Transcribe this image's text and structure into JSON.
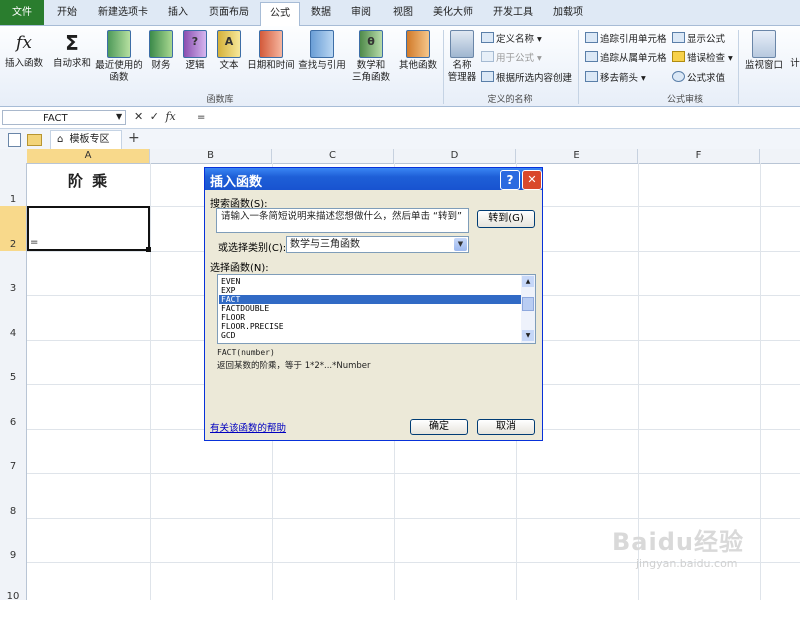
{
  "tabs": {
    "file": "文件",
    "home": "开始",
    "newtab": "新建选项卡",
    "insert": "插入",
    "layout": "页面布局",
    "formulas": "公式",
    "data": "数据",
    "review": "审阅",
    "view": "视图",
    "beauty": "美化大师",
    "dev": "开发工具",
    "addins": "加载项"
  },
  "ribbon": {
    "insert_function": "插入函数",
    "autosum_1": "自动求和",
    "recent_1": "最近使用的",
    "recent_2": "函数",
    "financial": "财务",
    "logical": "逻辑",
    "text": "文本",
    "datetime": "日期和时间",
    "lookup": "查找与引用",
    "math_1": "数学和",
    "math_2": "三角函数",
    "other": "其他函数",
    "group_library": "函数库",
    "name_mgr_1": "名称",
    "name_mgr_2": "管理器",
    "define_name": "定义名称",
    "use_in_formula": "用于公式",
    "create_from_sel": "根据所选内容创建",
    "group_names": "定义的名称",
    "trace_prec": "追踪引用单元格",
    "trace_dep": "追踪从属单元格",
    "remove_arrows": "移去箭头",
    "show_formulas": "显示公式",
    "error_check": "错误检查",
    "eval_formula": "公式求值",
    "group_audit": "公式审核",
    "watch_window": "监视窗口",
    "calc_trunc": "计",
    "fx_glyph": "fx",
    "sigma_glyph": "Σ",
    "text_glyph": "A",
    "theta_glyph": "θ",
    "q_glyph": "?"
  },
  "formula_bar": {
    "name_box": "FACT",
    "fx": "fx",
    "content": "="
  },
  "doc_tabs": {
    "template": "模板专区",
    "add": "+"
  },
  "columns": [
    "A",
    "B",
    "C",
    "D",
    "E",
    "F"
  ],
  "rows": [
    "1",
    "2",
    "3",
    "4",
    "5",
    "6",
    "7",
    "8",
    "9",
    "10"
  ],
  "cells": {
    "A1": "阶 乘",
    "A2": "="
  },
  "dialog": {
    "title": "插入函数",
    "help_btn": "?",
    "close_btn": "✕",
    "search_label": "搜索函数(S):",
    "search_value": "请输入一条简短说明来描述您想做什么，然后单击 “转到”",
    "go_btn": "转到(G)",
    "category_label": "或选择类别(C):",
    "category_value": "数学与三角函数",
    "select_label": "选择函数(N):",
    "functions": [
      "EVEN",
      "EXP",
      "FACT",
      "FACTDOUBLE",
      "FLOOR",
      "FLOOR.PRECISE",
      "GCD"
    ],
    "selected_function": "FACT",
    "signature": "FACT(number)",
    "description": "返回某数的阶乘，等于 1*2*...*Number",
    "help_link": "有关该函数的帮助",
    "ok_btn": "确定",
    "cancel_btn": "取消"
  },
  "watermark": {
    "line1": "Baidu经验",
    "line2": "jingyan.baidu.com"
  },
  "colors": {
    "file_tab": "#2a7d2e",
    "dialog_title": "#1e5fd7",
    "selection": "#316ac5",
    "close": "#d9482c"
  }
}
